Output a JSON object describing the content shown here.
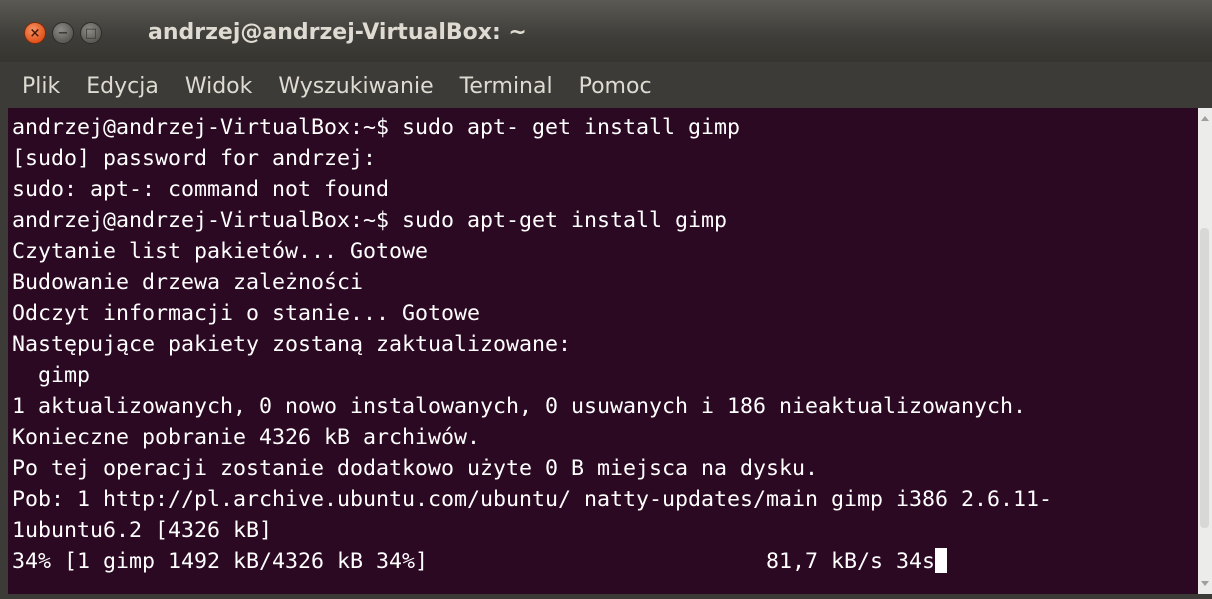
{
  "window": {
    "title": "andrzej@andrzej-VirtualBox: ~",
    "buttons": {
      "close_icon": "close-icon",
      "minimize_icon": "minimize-icon",
      "maximize_icon": "maximize-icon",
      "close_glyph": "×",
      "minimize_glyph": "−",
      "maximize_glyph": "□"
    }
  },
  "menu": {
    "items": [
      {
        "label": "Plik"
      },
      {
        "label": "Edycja"
      },
      {
        "label": "Widok"
      },
      {
        "label": "Wyszukiwanie"
      },
      {
        "label": "Terminal"
      },
      {
        "label": "Pomoc"
      }
    ]
  },
  "terminal": {
    "background": "#2c0922",
    "foreground": "#ffffff",
    "lines": [
      "andrzej@andrzej-VirtualBox:~$ sudo apt- get install gimp",
      "[sudo] password for andrzej:",
      "sudo: apt-: command not found",
      "andrzej@andrzej-VirtualBox:~$ sudo apt-get install gimp",
      "Czytanie list pakietów... Gotowe",
      "Budowanie drzewa zależności",
      "Odczyt informacji o stanie... Gotowe",
      "Następujące pakiety zostaną zaktualizowane:",
      "  gimp",
      "1 aktualizowanych, 0 nowo instalowanych, 0 usuwanych i 186 nieaktualizowanych.",
      "Konieczne pobranie 4326 kB archiwów.",
      "Po tej operacji zostanie dodatkowo użyte 0 B miejsca na dysku.",
      "Pob: 1 http://pl.archive.ubuntu.com/ubuntu/ natty-updates/main gimp i386 2.6.11-",
      "1ubuntu6.2 [4326 kB]",
      "34% [1 gimp 1492 kB/4326 kB 34%]                          81,7 kB/s 34s"
    ]
  }
}
